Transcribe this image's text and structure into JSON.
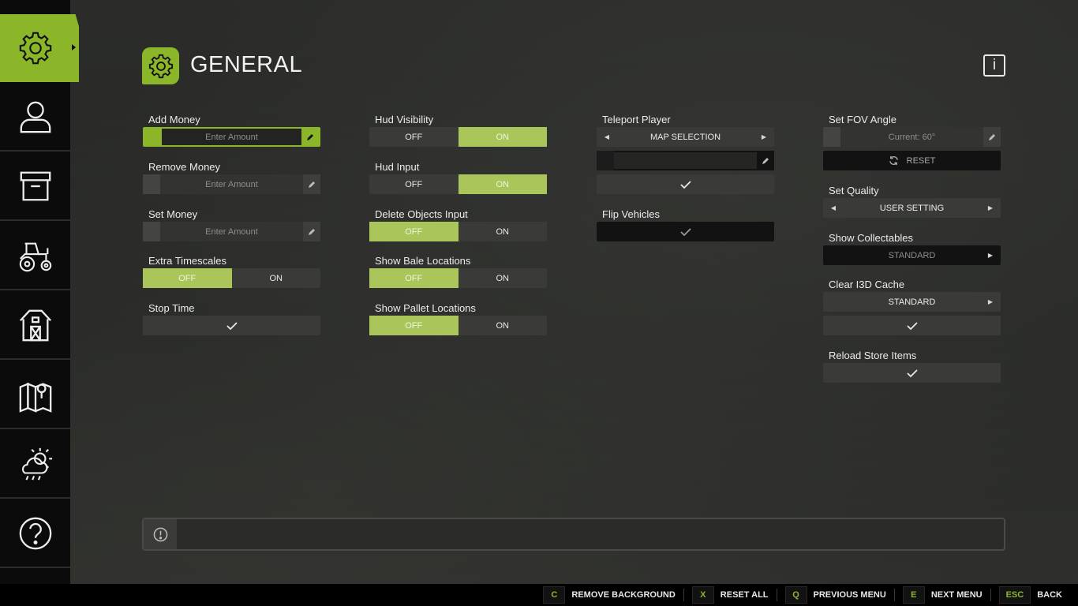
{
  "header": {
    "title": "GENERAL",
    "info_label": "i"
  },
  "sidebar": {
    "items": [
      {
        "name": "settings",
        "icon": "gear-icon",
        "active": true
      },
      {
        "name": "player",
        "icon": "user-icon"
      },
      {
        "name": "storage",
        "icon": "box-icon"
      },
      {
        "name": "vehicles",
        "icon": "tractor-icon"
      },
      {
        "name": "farm",
        "icon": "barn-icon"
      },
      {
        "name": "map",
        "icon": "map-icon"
      },
      {
        "name": "weather",
        "icon": "weather-icon"
      },
      {
        "name": "help",
        "icon": "help-icon"
      }
    ]
  },
  "columns": {
    "col1": {
      "add_money": {
        "label": "Add Money",
        "placeholder": "Enter Amount"
      },
      "remove_money": {
        "label": "Remove Money",
        "placeholder": "Enter Amount"
      },
      "set_money": {
        "label": "Set Money",
        "placeholder": "Enter Amount"
      },
      "extra_timescales": {
        "label": "Extra Timescales",
        "off": "OFF",
        "on": "ON",
        "selected": "OFF"
      },
      "stop_time": {
        "label": "Stop Time"
      }
    },
    "col2": {
      "hud_visibility": {
        "label": "Hud Visibility",
        "off": "OFF",
        "on": "ON",
        "selected": "ON"
      },
      "hud_input": {
        "label": "Hud Input",
        "off": "OFF",
        "on": "ON",
        "selected": "ON"
      },
      "delete_objects_input": {
        "label": "Delete Objects Input",
        "off": "OFF",
        "on": "ON",
        "selected": "OFF"
      },
      "show_bale_locations": {
        "label": "Show Bale Locations",
        "off": "OFF",
        "on": "ON",
        "selected": "OFF"
      },
      "show_pallet_locations": {
        "label": "Show Pallet Locations",
        "off": "OFF",
        "on": "ON",
        "selected": "OFF"
      }
    },
    "col3": {
      "teleport_player": {
        "label": "Teleport Player",
        "value": "MAP SELECTION"
      },
      "flip_vehicles": {
        "label": "Flip Vehicles"
      }
    },
    "col4": {
      "set_fov_angle": {
        "label": "Set FOV Angle",
        "placeholder": "Current: 60°",
        "reset_label": "RESET"
      },
      "set_quality": {
        "label": "Set Quality",
        "value": "USER SETTING"
      },
      "show_collectables": {
        "label": "Show Collectables",
        "value": "STANDARD"
      },
      "clear_i3d_cache": {
        "label": "Clear I3D Cache",
        "value": "STANDARD"
      },
      "reload_store_items": {
        "label": "Reload Store Items"
      }
    }
  },
  "bottom_bar": {
    "hints": [
      {
        "key": "C",
        "label": "REMOVE BACKGROUND"
      },
      {
        "key": "X",
        "label": "RESET ALL"
      },
      {
        "key": "Q",
        "label": "PREVIOUS MENU"
      },
      {
        "key": "E",
        "label": "NEXT MENU"
      },
      {
        "key": "ESC",
        "label": "BACK"
      }
    ]
  },
  "colors": {
    "accent": "#8cb62a",
    "toggle_selected": "#aac65a",
    "sidebar_bg": "#0b0b0b"
  }
}
